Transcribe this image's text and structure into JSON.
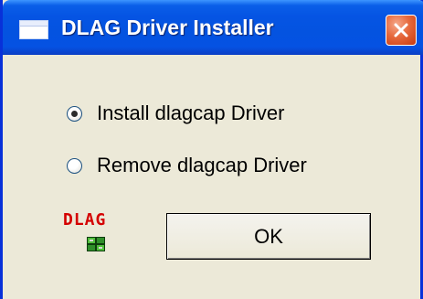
{
  "window": {
    "title": "DLAG Driver Installer",
    "title_icon": "window-icon",
    "close_icon": "close-icon",
    "accent_color": "#0554e3",
    "close_color": "#e6693d"
  },
  "options": {
    "install_label": "Install dlagcap Driver",
    "install_selected": true,
    "remove_label": "Remove dlagcap Driver",
    "remove_selected": false
  },
  "logo": {
    "text": "DLAG",
    "icon": "chip-icon",
    "color": "#d40000"
  },
  "buttons": {
    "ok_label": "OK"
  }
}
